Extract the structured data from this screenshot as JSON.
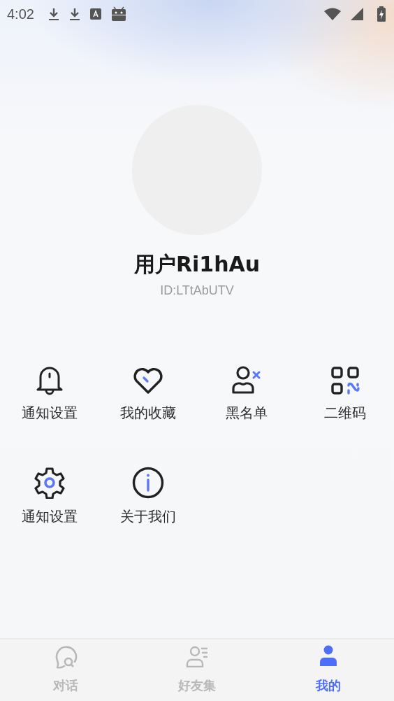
{
  "status_bar": {
    "time": "4:02"
  },
  "profile": {
    "name": "用户Ri1hAu",
    "id": "ID:LTtAbUTV"
  },
  "menu": [
    {
      "kind": "bell",
      "label": "通知设置"
    },
    {
      "kind": "heart",
      "label": "我的收藏"
    },
    {
      "kind": "user-block",
      "label": "黑名单"
    },
    {
      "kind": "qr",
      "label": "二维码"
    },
    {
      "kind": "gear",
      "label": "通知设置"
    },
    {
      "kind": "info",
      "label": "关于我们"
    }
  ],
  "tabs": [
    {
      "kind": "chat",
      "label": "对话",
      "selected": false
    },
    {
      "kind": "friends",
      "label": "好友集",
      "selected": false
    },
    {
      "kind": "me",
      "label": "我的",
      "selected": true
    }
  ]
}
